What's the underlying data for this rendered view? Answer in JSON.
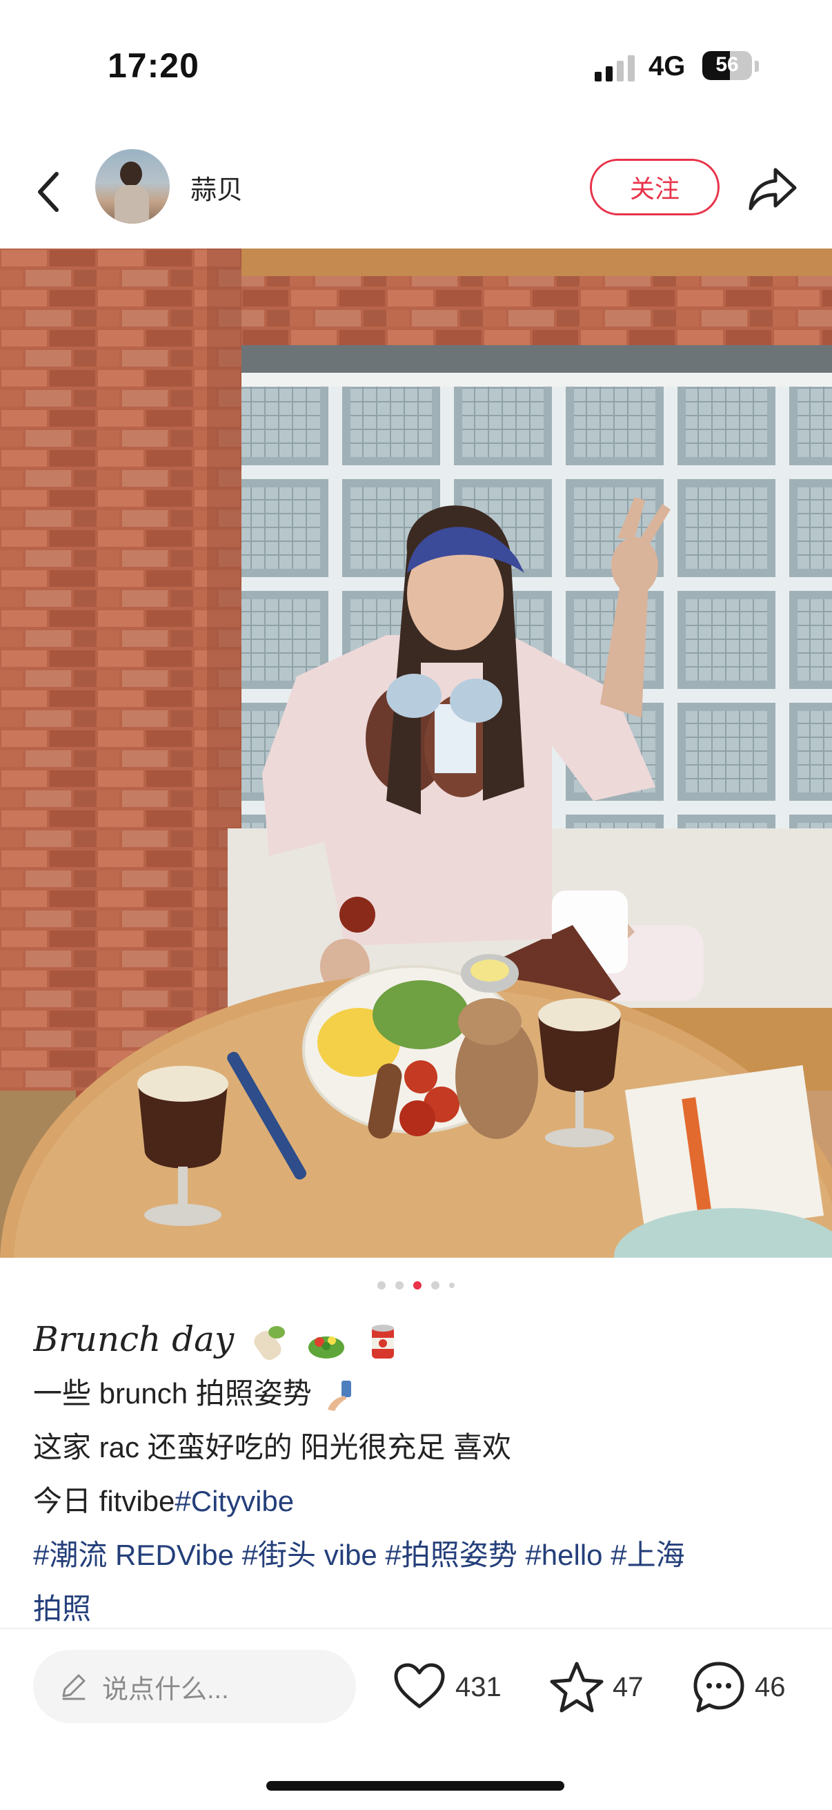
{
  "status_bar": {
    "time": "17:20",
    "network": "4G",
    "battery": "56",
    "battery_level": 0.56
  },
  "header": {
    "author_name": "蒜贝",
    "follow_label": "关注",
    "icons": [
      "back-icon",
      "avatar",
      "share-icon"
    ]
  },
  "carousel": {
    "total": 5,
    "active_index": 2
  },
  "post": {
    "title": "Brunch day",
    "title_emojis": [
      "burrito-emoji",
      "salad-emoji",
      "canned-food-emoji"
    ],
    "line1": "一些 brunch 拍照姿势",
    "line1_emoji": "selfie-emoji",
    "line2": "这家 rac 还蛮好吃的 阳光很充足 喜欢",
    "line3_text": "今日 fitvibe",
    "line3_tag": "#Cityvibe",
    "tags_line": "#潮流 REDVibe #街头 vibe #拍照姿势 #hello #上海",
    "tags_line_cont": "拍照"
  },
  "bottom_bar": {
    "comment_placeholder": "说点什么...",
    "likes": "431",
    "favorites": "47",
    "comments": "46"
  },
  "colors": {
    "accent": "#e8334a",
    "hashtag": "#243f7a"
  }
}
